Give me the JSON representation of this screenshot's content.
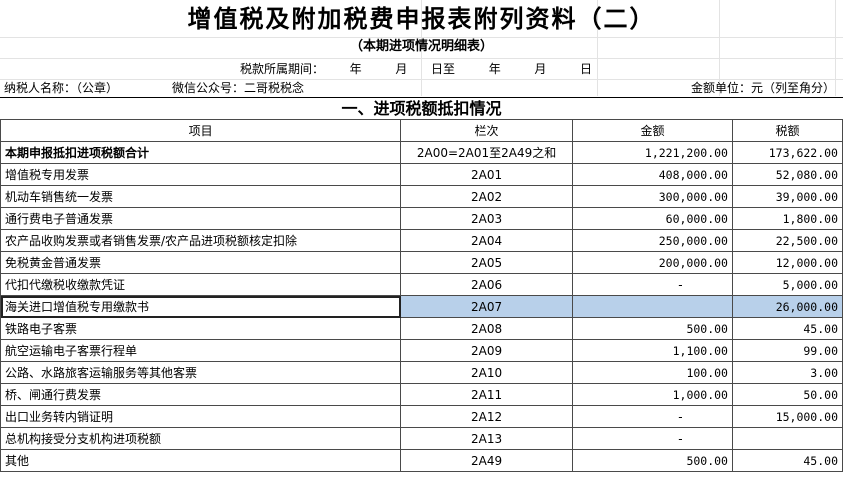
{
  "header": {
    "title": "增值税及附加税费申报表附列资料（二）",
    "subtitle": "（本期进项情况明细表）",
    "period_label": "税款所属期间：",
    "period_year1": "年",
    "period_month1": "月",
    "period_day_to": "日至",
    "period_year2": "年",
    "period_month2": "月",
    "period_day2": "日",
    "taxpayer_label": "纳税人名称：（公章）",
    "wechat_label": "微信公众号：二哥税税念",
    "unit_label": "金额单位：元（列至角分）"
  },
  "section_title": "一、进项税额抵扣情况",
  "table": {
    "columns": [
      "项目",
      "栏次",
      "金额",
      "税额"
    ],
    "rows": [
      {
        "item": "本期申报抵扣进项税额合计",
        "code": "2A00=2A01至2A49之和",
        "amount": "1,221,200.00",
        "tax": "173,622.00"
      },
      {
        "item": "增值税专用发票",
        "code": "2A01",
        "amount": "408,000.00",
        "tax": "52,080.00"
      },
      {
        "item": "机动车销售统一发票",
        "code": "2A02",
        "amount": "300,000.00",
        "tax": "39,000.00"
      },
      {
        "item": "通行费电子普通发票",
        "code": "2A03",
        "amount": "60,000.00",
        "tax": "1,800.00"
      },
      {
        "item": "农产品收购发票或者销售发票/农产品进项税额核定扣除",
        "code": "2A04",
        "amount": "250,000.00",
        "tax": "22,500.00"
      },
      {
        "item": "免税黄金普通发票",
        "code": "2A05",
        "amount": "200,000.00",
        "tax": "12,000.00"
      },
      {
        "item": "代扣代缴税收缴款凭证",
        "code": "2A06",
        "amount": "-",
        "tax": "5,000.00"
      },
      {
        "item": "海关进口增值税专用缴款书",
        "code": "2A07",
        "amount": "",
        "tax": "26,000.00"
      },
      {
        "item": "铁路电子客票",
        "code": "2A08",
        "amount": "500.00",
        "tax": "45.00"
      },
      {
        "item": "航空运输电子客票行程单",
        "code": "2A09",
        "amount": "1,100.00",
        "tax": "99.00"
      },
      {
        "item": "公路、水路旅客运输服务等其他客票",
        "code": "2A10",
        "amount": "100.00",
        "tax": "3.00"
      },
      {
        "item": "桥、闸通行费发票",
        "code": "2A11",
        "amount": "1,000.00",
        "tax": "50.00"
      },
      {
        "item": "出口业务转内销证明",
        "code": "2A12",
        "amount": "-",
        "tax": "15,000.00"
      },
      {
        "item": "总机构接受分支机构进项税额",
        "code": "2A13",
        "amount": "-",
        "tax": ""
      },
      {
        "item": "其他",
        "code": "2A49",
        "amount": "500.00",
        "tax": "45.00"
      }
    ]
  },
  "colors": {
    "selection_fill": "#b8d0ea",
    "grid_line": "#4a4a4a"
  }
}
